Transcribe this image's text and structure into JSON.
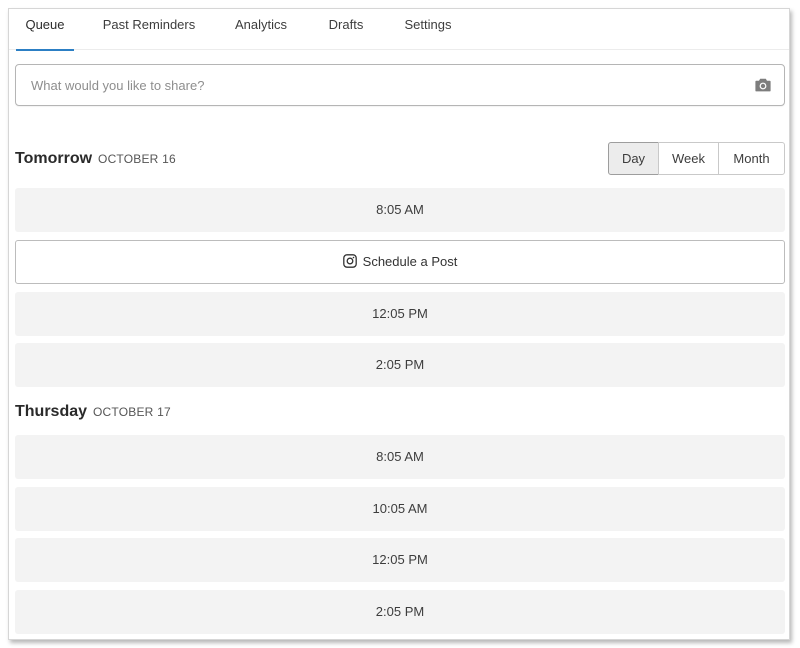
{
  "tabs": [
    {
      "label": "Queue",
      "active": true
    },
    {
      "label": "Past Reminders",
      "active": false
    },
    {
      "label": "Analytics",
      "active": false
    },
    {
      "label": "Drafts",
      "active": false
    },
    {
      "label": "Settings",
      "active": false
    }
  ],
  "composer": {
    "placeholder": "What would you like to share?",
    "value": "",
    "icon": "camera-icon"
  },
  "view_toggle": {
    "options": [
      "Day",
      "Week",
      "Month"
    ],
    "selected": "Day"
  },
  "days": [
    {
      "name": "Tomorrow",
      "date": "OCTOBER 16",
      "slots": [
        {
          "time": "8:05 AM",
          "scheduled": false
        },
        {
          "label": "Schedule a Post",
          "scheduled": true,
          "icon": "instagram-icon"
        },
        {
          "time": "12:05 PM",
          "scheduled": false
        },
        {
          "time": "2:05 PM",
          "scheduled": false
        }
      ]
    },
    {
      "name": "Thursday",
      "date": "OCTOBER 17",
      "slots": [
        {
          "time": "8:05 AM",
          "scheduled": false
        },
        {
          "time": "10:05 AM",
          "scheduled": false
        },
        {
          "time": "12:05 PM",
          "scheduled": false
        },
        {
          "time": "2:05 PM",
          "scheduled": false
        }
      ]
    }
  ],
  "colors": {
    "accent": "#2c7fc4",
    "slot_background": "#f3f3f3",
    "border": "#bcbcbc"
  }
}
